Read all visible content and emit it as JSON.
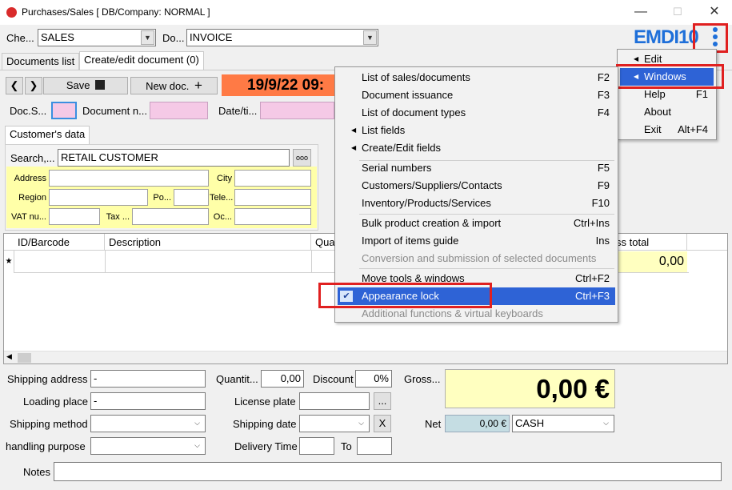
{
  "window": {
    "title": "Purchases/Sales   [ DB/Company: NORMAL ]",
    "minimize": "—",
    "maximize": "☐",
    "close": "✕"
  },
  "header": {
    "che_label": "Che...",
    "che_value": "SALES",
    "do_label": "Do...",
    "do_value": "INVOICE",
    "logo_text": "EMDI10"
  },
  "tabs": [
    {
      "label": "Documents list"
    },
    {
      "label": "Create/edit document (0)"
    }
  ],
  "toolbar": {
    "save_label": "Save",
    "newdoc_label": "New doc.",
    "date_value": "19/9/22 09:"
  },
  "docfields": {
    "docs_label": "Doc.S...",
    "docn_label": "Document n...",
    "date_label": "Date/ti..."
  },
  "customer": {
    "tab_label": "Customer's data",
    "search_label": "Search,...",
    "search_value": "RETAIL CUSTOMER",
    "search_btn": "ooo",
    "address_label": "Address",
    "city_label": "City",
    "region_label": "Region",
    "po_label": "Po...",
    "tele_label": "Tele...",
    "vat_label": "VAT nu...",
    "tax_label": "Tax ...",
    "oc_label": "Oc..."
  },
  "grid": {
    "columns": [
      "ID/Barcode",
      "Description",
      "Quan",
      "ss total"
    ],
    "newrow_marker": "★",
    "total_value": "0,00"
  },
  "footer": {
    "shipping_address_label": "Shipping address",
    "shipping_address_value": "-",
    "loading_place_label": "Loading place",
    "loading_place_value": "-",
    "shipping_method_label": "Shipping method",
    "handling_purpose_label": "handling purpose",
    "quantity_label": "Quantit...",
    "quantity_value": "0,00",
    "discount_label": "Discount",
    "discount_value": "0%",
    "license_plate_label": "License plate",
    "license_btn": "...",
    "shipping_date_label": "Shipping date",
    "shipping_date_clear": "X",
    "delivery_time_label": "Delivery Time",
    "to_label": "To",
    "gross_label": "Gross...",
    "gross_value": "0,00 €",
    "net_label": "Net",
    "net_value": "0,00 €",
    "payment_value": "CASH",
    "notes_label": "Notes"
  },
  "main_menu": {
    "items": [
      {
        "label": "Edit",
        "shortcut": "",
        "submenu": true
      },
      {
        "label": "Windows",
        "shortcut": "",
        "submenu": true
      },
      {
        "label": "Help",
        "shortcut": "F1"
      },
      {
        "label": "About",
        "shortcut": ""
      },
      {
        "label": "Exit",
        "shortcut": "Alt+F4"
      }
    ]
  },
  "windows_menu": {
    "items": [
      {
        "label": "List of sales/documents",
        "shortcut": "F2"
      },
      {
        "label": "Document issuance",
        "shortcut": "F3"
      },
      {
        "label": "List of document types",
        "shortcut": "F4"
      },
      {
        "label": "List fields",
        "shortcut": ""
      },
      {
        "label": "Create/Edit fields",
        "shortcut": ""
      },
      {
        "label": "Serial numbers",
        "shortcut": "F5"
      },
      {
        "label": "Customers/Suppliers/Contacts",
        "shortcut": "F9"
      },
      {
        "label": "Inventory/Products/Services",
        "shortcut": "F10"
      },
      {
        "label": "Bulk product creation & import",
        "shortcut": "Ctrl+Ins"
      },
      {
        "label": "Import of items guide",
        "shortcut": "Ins"
      },
      {
        "label": "Conversion and submission of selected documents",
        "shortcut": ""
      },
      {
        "label": "Move tools & windows",
        "shortcut": "Ctrl+F2"
      },
      {
        "label": "Appearance lock",
        "shortcut": "Ctrl+F3"
      },
      {
        "label": "Additional functions & virtual keyboards",
        "shortcut": ""
      }
    ],
    "check_mark": "✔"
  },
  "colors": {
    "highlight": "#2e63d6",
    "date_banner": "#ff7a45",
    "yellow_panel": "#ffffa8",
    "pink_field": "#f5c9e6",
    "annotation_red": "#e02020"
  }
}
